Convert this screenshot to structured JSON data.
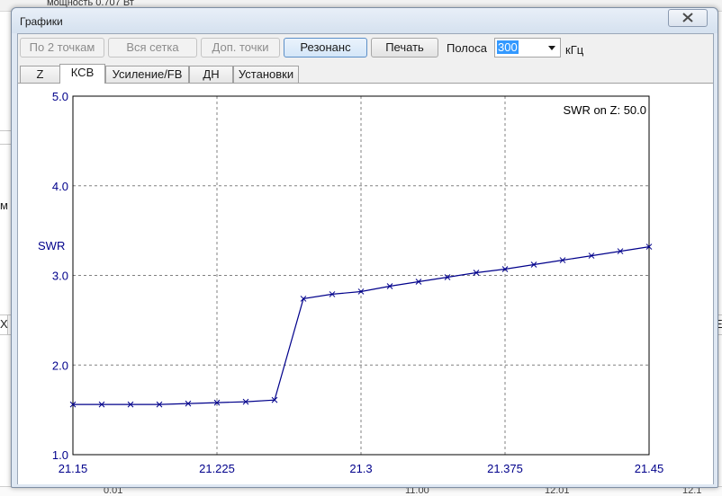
{
  "window": {
    "title": "Графики",
    "close_label": "✕"
  },
  "toolbar": {
    "buttons": [
      {
        "label": "По 2 точкам",
        "enabled": false
      },
      {
        "label": "Вся сетка",
        "enabled": false
      },
      {
        "label": "Доп. точки",
        "enabled": false
      },
      {
        "label": "Резонанс",
        "enabled": true,
        "active": true
      },
      {
        "label": "Печать",
        "enabled": true
      }
    ],
    "band_label": "Полоса",
    "band_value": "300",
    "band_unit": "кГц"
  },
  "tabs": [
    {
      "label": "Z",
      "selected": false
    },
    {
      "label": "КСВ",
      "selected": true
    },
    {
      "label": "Усиление/FB",
      "selected": false
    },
    {
      "label": "ДН",
      "selected": false
    },
    {
      "label": "Установки",
      "selected": false
    }
  ],
  "background": {
    "top_text": "мощность 0.707 Вт",
    "left_text_1": "м",
    "left_text_2": "X",
    "right_text": "E",
    "bottom_text_1": "0.01",
    "bottom_text_2": "11.00",
    "bottom_text_3": "12.01",
    "bottom_text_4": "12.1"
  },
  "chart_data": {
    "type": "line",
    "ylabel": "SWR",
    "annotation": "SWR on Z: 50.0",
    "xlim": [
      21.15,
      21.45
    ],
    "ylim": [
      1.0,
      5.0
    ],
    "x_ticks": [
      "21.15",
      "21.225",
      "21.3",
      "21.375",
      "21.45"
    ],
    "y_ticks": [
      "1.0",
      "2.0",
      "3.0",
      "4.0",
      "5.0"
    ],
    "grid": true,
    "colors": {
      "series": "#00008b",
      "axis_text": "#00008b",
      "grid": "#808080"
    },
    "series": [
      {
        "x": [
          21.15,
          21.165,
          21.18,
          21.195,
          21.21,
          21.225,
          21.24,
          21.255,
          21.27,
          21.285,
          21.3,
          21.315,
          21.33,
          21.345,
          21.36,
          21.375,
          21.39,
          21.405,
          21.42,
          21.435,
          21.45
        ],
        "y": [
          1.56,
          1.56,
          1.56,
          1.56,
          1.57,
          1.58,
          1.59,
          1.61,
          2.74,
          2.79,
          2.82,
          2.88,
          2.93,
          2.98,
          3.03,
          3.07,
          3.12,
          3.17,
          3.22,
          3.27,
          3.32
        ]
      }
    ]
  }
}
